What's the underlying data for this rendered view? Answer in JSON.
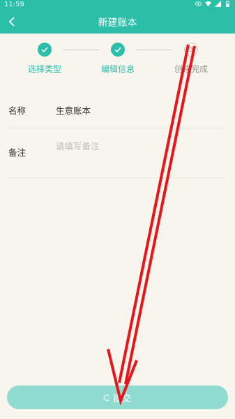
{
  "status": {
    "time": "11:59"
  },
  "header": {
    "title": "新建账本"
  },
  "steps": [
    {
      "label": "选择类型",
      "state": "done"
    },
    {
      "label": "编辑信息",
      "state": "done"
    },
    {
      "label": "创建完成",
      "state": "todo",
      "number": "3"
    }
  ],
  "form": {
    "name_label": "名称",
    "name_value": "生意账本",
    "remark_label": "备注",
    "remark_placeholder": "请填写备注"
  },
  "submit": {
    "label": "提交"
  },
  "watermark": "·····",
  "colors": {
    "accent": "#2bbfa9",
    "button": "#8fdbd0",
    "annotation": "#e8161b"
  }
}
